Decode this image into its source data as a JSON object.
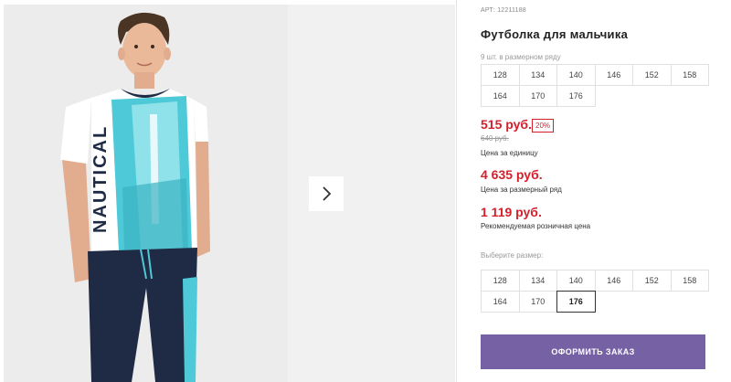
{
  "product": {
    "article": "АРТ: 12211188",
    "title": "Футболка для мальчика",
    "pack_hint": "9 шт. в размерном ряду",
    "pack_sizes": [
      "128",
      "134",
      "140",
      "146",
      "152",
      "158",
      "164",
      "170",
      "176"
    ],
    "price": "515 руб.",
    "discount": "20%",
    "old_price": "640 руб.",
    "price_unit_label": "Цена за единицу",
    "pack_price": "4 635 руб.",
    "pack_price_label": "Цена за размерный ряд",
    "retail_price": "1 119 руб.",
    "retail_price_label": "Рекомендуемая розничная цена",
    "print_text": "NAUTICAL"
  },
  "size_picker": {
    "label": "Выберите размер:",
    "options": [
      "128",
      "134",
      "140",
      "146",
      "152",
      "158",
      "164",
      "170",
      "176"
    ],
    "selected": "176"
  },
  "order_button": {
    "label": "ОФОРМИТЬ ЗАКАЗ"
  },
  "gallery": {
    "next_icon": "chevron-right-icon"
  },
  "colors": {
    "accent_button": "#7561a4",
    "price_red": "#d51f2b",
    "shirt_turquoise": "#4ec9d8",
    "pants_navy": "#1f2a44"
  }
}
